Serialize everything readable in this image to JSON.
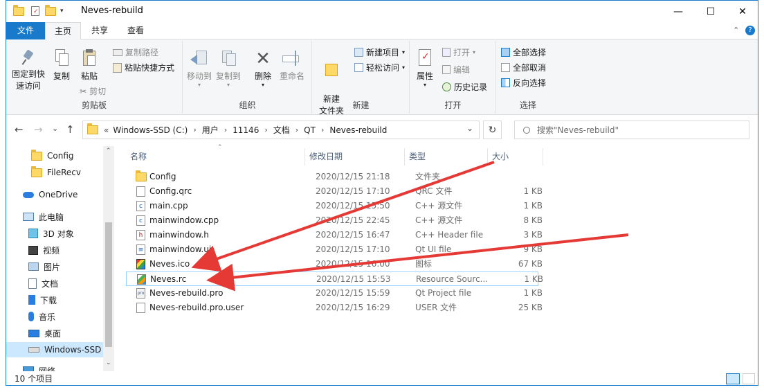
{
  "window": {
    "title": "Neves-rebuild",
    "minimize": "—",
    "maximize": "☐",
    "close": "✕"
  },
  "tabs": [
    {
      "label": "文件"
    },
    {
      "label": "主页"
    },
    {
      "label": "共享"
    },
    {
      "label": "查看"
    }
  ],
  "ribbon": {
    "clipboard": {
      "label": "剪贴板",
      "pin": "固定到快速访问",
      "copy": "复制",
      "paste": "粘贴",
      "copy_path": "复制路径",
      "paste_shortcut": "粘贴快捷方式",
      "cut": "剪切"
    },
    "organize": {
      "label": "组织",
      "move_to": "移动到",
      "copy_to": "复制到",
      "delete": "删除",
      "rename": "重命名"
    },
    "new": {
      "label": "新建",
      "new_folder": "新建\n文件夹",
      "new_item": "新建项目",
      "easy_access": "轻松访问"
    },
    "open": {
      "label": "打开",
      "properties": "属性",
      "open": "打开",
      "edit": "编辑",
      "history": "历史记录"
    },
    "select": {
      "label": "选择",
      "select_all": "全部选择",
      "select_none": "全部取消",
      "invert": "反向选择"
    }
  },
  "address": {
    "back": "←",
    "forward": "→",
    "recent": "⌄",
    "up": "↑",
    "overflow": "«",
    "crumbs": [
      "Windows-SSD (C:)",
      "用户",
      "11146",
      "文档",
      "QT",
      "Neves-rebuild"
    ],
    "dropdown": "⌄",
    "refresh": "↻",
    "search_placeholder": "搜索\"Neves-rebuild\""
  },
  "nav": {
    "items": [
      {
        "label": "Config",
        "icon": "folder-icon"
      },
      {
        "label": "FileRecv",
        "icon": "folder-icon"
      },
      {
        "label": "OneDrive",
        "icon": "cloud-icon"
      },
      {
        "label": "此电脑",
        "icon": "computer-icon"
      },
      {
        "label": "3D 对象",
        "icon": "cube-icon"
      },
      {
        "label": "视频",
        "icon": "video-icon"
      },
      {
        "label": "图片",
        "icon": "picture-icon"
      },
      {
        "label": "文档",
        "icon": "document-icon"
      },
      {
        "label": "下载",
        "icon": "download-icon"
      },
      {
        "label": "音乐",
        "icon": "music-icon"
      },
      {
        "label": "桌面",
        "icon": "desktop-icon"
      },
      {
        "label": "Windows-SSD",
        "icon": "drive-icon"
      },
      {
        "label": "网络",
        "icon": "network-icon"
      }
    ]
  },
  "columns": {
    "name": "名称",
    "date": "修改日期",
    "type": "类型",
    "size": "大小"
  },
  "files": [
    {
      "name": "Config",
      "date": "2020/12/15 21:18",
      "type": "文件夹",
      "size": "",
      "icon": "folder-icon"
    },
    {
      "name": "Config.qrc",
      "date": "2020/12/15 17:10",
      "type": "QRC 文件",
      "size": "1 KB",
      "icon": "file-icon"
    },
    {
      "name": "main.cpp",
      "date": "2020/12/15 15:50",
      "type": "C++ 源文件",
      "size": "1 KB",
      "icon": "cpp-file-icon"
    },
    {
      "name": "mainwindow.cpp",
      "date": "2020/12/15 22:45",
      "type": "C++ 源文件",
      "size": "8 KB",
      "icon": "cpp-file-icon"
    },
    {
      "name": "mainwindow.h",
      "date": "2020/12/15 16:47",
      "type": "C++ Header file",
      "size": "3 KB",
      "icon": "header-file-icon"
    },
    {
      "name": "mainwindow.ui",
      "date": "2020/12/15 17:10",
      "type": "Qt UI file",
      "size": "9 KB",
      "icon": "ui-file-icon"
    },
    {
      "name": "Neves.ico",
      "date": "2020/12/15 16:00",
      "type": "图标",
      "size": "67 KB",
      "icon": "ico-file-icon"
    },
    {
      "name": "Neves.rc",
      "date": "2020/12/15 15:53",
      "type": "Resource Sourc...",
      "size": "1 KB",
      "icon": "rc-file-icon"
    },
    {
      "name": "Neves-rebuild.pro",
      "date": "2020/12/15 15:59",
      "type": "Qt Project file",
      "size": "1 KB",
      "icon": "pro-file-icon"
    },
    {
      "name": "Neves-rebuild.pro.user",
      "date": "2020/12/15 16:29",
      "type": "USER 文件",
      "size": "25 KB",
      "icon": "file-icon"
    }
  ],
  "status": {
    "count": "10 个项目"
  },
  "colors": {
    "accent": "#1979ca",
    "arrow": "#e53935",
    "selection": "#cce8ff"
  }
}
